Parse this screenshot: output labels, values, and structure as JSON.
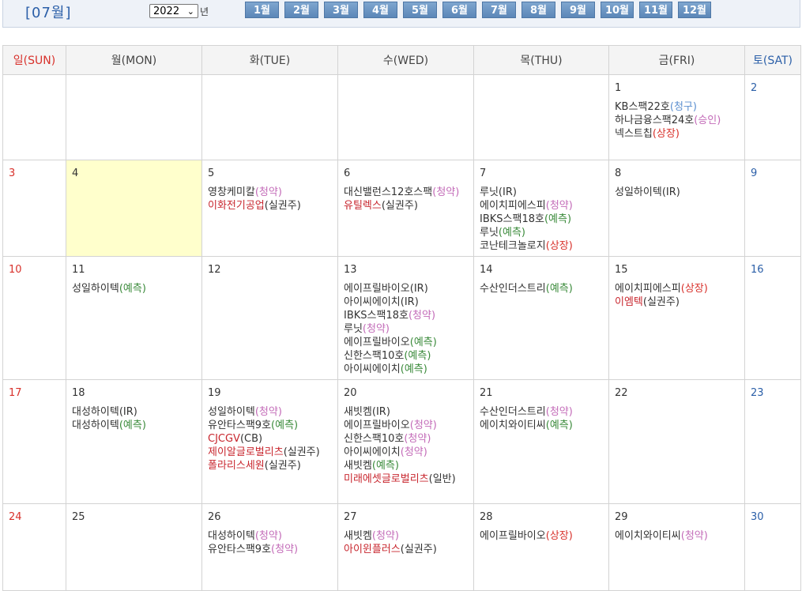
{
  "header": {
    "month_title": "[07월]",
    "year_value": "2022",
    "year_suffix": "년",
    "months": [
      "1월",
      "2월",
      "3월",
      "4월",
      "5월",
      "6월",
      "7월",
      "8월",
      "9월",
      "10월",
      "11월",
      "12월"
    ]
  },
  "weekdays": [
    "일(SUN)",
    "월(MON)",
    "화(TUE)",
    "수(WED)",
    "목(THU)",
    "금(FRI)",
    "토(SAT)"
  ],
  "colors": {
    "sunday": "#d8312b",
    "saturday": "#2b5fa8",
    "today": "#ffffcc",
    "subscription": "#c36bb8",
    "forecast": "#3a8a3a",
    "listing": "#d8312b"
  },
  "weeks": [
    [
      {
        "day": "",
        "events": []
      },
      {
        "day": "",
        "events": []
      },
      {
        "day": "",
        "events": []
      },
      {
        "day": "",
        "events": []
      },
      {
        "day": "",
        "events": []
      },
      {
        "day": "1",
        "events": [
          {
            "name": "KB스팩22호",
            "tag": "청구",
            "red": false
          },
          {
            "name": "하나금융스팩24호",
            "tag": "승인",
            "red": false
          },
          {
            "name": "넥스트칩",
            "tag": "상장",
            "red": false
          }
        ]
      },
      {
        "day": "2",
        "events": []
      }
    ],
    [
      {
        "day": "3",
        "events": []
      },
      {
        "day": "4",
        "today": true,
        "events": []
      },
      {
        "day": "5",
        "events": [
          {
            "name": "영창케미칼",
            "tag": "청약",
            "red": false
          },
          {
            "name": "이화전기공업",
            "tag": "실권주",
            "red": true
          }
        ]
      },
      {
        "day": "6",
        "events": [
          {
            "name": "대신밸런스12호스팩",
            "tag": "청약",
            "red": false
          },
          {
            "name": "유틸렉스",
            "tag": "실권주",
            "red": true
          }
        ]
      },
      {
        "day": "7",
        "events": [
          {
            "name": "루닛",
            "tag": "IR",
            "red": false
          },
          {
            "name": "에이치피에스피",
            "tag": "청약",
            "red": false
          },
          {
            "name": "IBKS스팩18호",
            "tag": "예측",
            "red": false
          },
          {
            "name": "루닛",
            "tag": "예측",
            "red": false
          },
          {
            "name": "코난테크놀로지",
            "tag": "상장",
            "red": false
          }
        ]
      },
      {
        "day": "8",
        "events": [
          {
            "name": "성일하이텍",
            "tag": "IR",
            "red": false
          }
        ]
      },
      {
        "day": "9",
        "events": []
      }
    ],
    [
      {
        "day": "10",
        "events": []
      },
      {
        "day": "11",
        "events": [
          {
            "name": "성일하이텍",
            "tag": "예측",
            "red": false
          }
        ]
      },
      {
        "day": "12",
        "events": []
      },
      {
        "day": "13",
        "events": [
          {
            "name": "에이프릴바이오",
            "tag": "IR",
            "red": false
          },
          {
            "name": "아이씨에이치",
            "tag": "IR",
            "red": false
          },
          {
            "name": "IBKS스팩18호",
            "tag": "청약",
            "red": false
          },
          {
            "name": "루닛",
            "tag": "청약",
            "red": false
          },
          {
            "name": "에이프릴바이오",
            "tag": "예측",
            "red": false
          },
          {
            "name": "신한스팩10호",
            "tag": "예측",
            "red": false
          },
          {
            "name": "아이씨에이치",
            "tag": "예측",
            "red": false
          }
        ]
      },
      {
        "day": "14",
        "events": [
          {
            "name": "수산인더스트리",
            "tag": "예측",
            "red": false
          }
        ]
      },
      {
        "day": "15",
        "events": [
          {
            "name": "에이치피에스피",
            "tag": "상장",
            "red": false
          },
          {
            "name": "이엠텍",
            "tag": "실권주",
            "red": true
          }
        ]
      },
      {
        "day": "16",
        "events": []
      }
    ],
    [
      {
        "day": "17",
        "events": []
      },
      {
        "day": "18",
        "events": [
          {
            "name": "대성하이텍",
            "tag": "IR",
            "red": false
          },
          {
            "name": "대성하이텍",
            "tag": "예측",
            "red": false
          }
        ]
      },
      {
        "day": "19",
        "events": [
          {
            "name": "성일하이텍",
            "tag": "청약",
            "red": false
          },
          {
            "name": "유안타스팩9호",
            "tag": "예측",
            "red": false
          },
          {
            "name": "CJCGV",
            "tag": "CB",
            "red": true
          },
          {
            "name": "제이알글로벌리츠",
            "tag": "실권주",
            "red": true
          },
          {
            "name": "폴라리스세원",
            "tag": "실권주",
            "red": true
          }
        ]
      },
      {
        "day": "20",
        "events": [
          {
            "name": "새빗켐",
            "tag": "IR",
            "red": false
          },
          {
            "name": "에이프릴바이오",
            "tag": "청약",
            "red": false
          },
          {
            "name": "신한스팩10호",
            "tag": "청약",
            "red": false
          },
          {
            "name": "아이씨에이치",
            "tag": "청약",
            "red": false
          },
          {
            "name": "새빗켐",
            "tag": "예측",
            "red": false
          },
          {
            "name": "미래에셋글로벌리츠",
            "tag": "일반",
            "red": true
          }
        ]
      },
      {
        "day": "21",
        "events": [
          {
            "name": "수산인더스트리",
            "tag": "청약",
            "red": false
          },
          {
            "name": "에이치와이티씨",
            "tag": "예측",
            "red": false
          }
        ]
      },
      {
        "day": "22",
        "events": []
      },
      {
        "day": "23",
        "events": []
      }
    ],
    [
      {
        "day": "24",
        "events": []
      },
      {
        "day": "25",
        "events": []
      },
      {
        "day": "26",
        "events": [
          {
            "name": "대성하이텍",
            "tag": "청약",
            "red": false
          },
          {
            "name": "유안타스팩9호",
            "tag": "청약",
            "red": false
          }
        ]
      },
      {
        "day": "27",
        "events": [
          {
            "name": "새빗켐",
            "tag": "청약",
            "red": false
          },
          {
            "name": "아이윈플러스",
            "tag": "실권주",
            "red": true
          }
        ]
      },
      {
        "day": "28",
        "events": [
          {
            "name": "에이프릴바이오",
            "tag": "상장",
            "red": false
          }
        ]
      },
      {
        "day": "29",
        "events": [
          {
            "name": "에이치와이티씨",
            "tag": "청약",
            "red": false
          }
        ]
      },
      {
        "day": "30",
        "events": []
      }
    ]
  ]
}
